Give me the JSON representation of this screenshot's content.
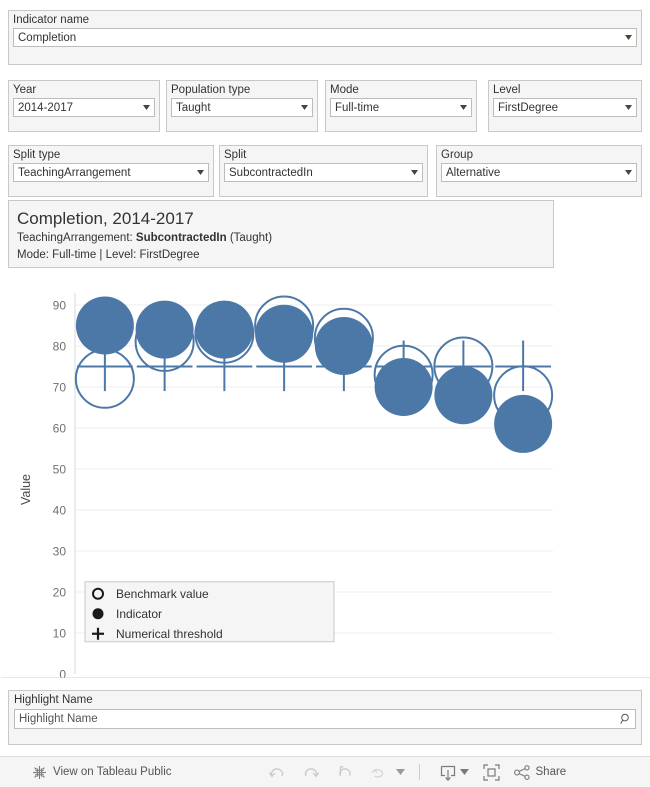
{
  "filters": {
    "indicator": {
      "label": "Indicator name",
      "value": "Completion"
    },
    "year": {
      "label": "Year",
      "value": "2014-2017"
    },
    "population_type": {
      "label": "Population type",
      "value": "Taught"
    },
    "mode": {
      "label": "Mode",
      "value": "Full-time"
    },
    "level": {
      "label": "Level",
      "value": "FirstDegree"
    },
    "split_type": {
      "label": "Split type",
      "value": "TeachingArrangement"
    },
    "split": {
      "label": "Split",
      "value": "SubcontractedIn"
    },
    "group": {
      "label": "Group",
      "value": "Alternative"
    }
  },
  "title_card": {
    "main": "Completion, 2014-2017",
    "sub1_prefix": "TeachingArrangement: ",
    "sub1_bold": "SubcontractedIn",
    "sub1_suffix": " (Taught)",
    "sub2": "Mode: Full-time | Level: FirstDegree"
  },
  "highlight": {
    "label": "Highlight Name",
    "value": "Highlight Name",
    "placeholder": "Highlight Name",
    "icon": "search-icon"
  },
  "toolbar": {
    "logo_icon": "tableau-logo-icon",
    "view_label": "View on Tableau Public",
    "undo_icon": "undo-icon",
    "redo_icon": "redo-icon",
    "revert_icon": "revert-icon",
    "refresh_icon": "refresh-icon",
    "pause_caret_icon": "chevron-down-icon",
    "download_icon": "download-icon",
    "download_caret_icon": "chevron-down-icon",
    "fullscreen_icon": "fullscreen-icon",
    "share_icon": "share-icon",
    "share_label": "Share"
  },
  "colors": {
    "mark_blue": "#4c78a8",
    "panel_bg": "#f5f5f5",
    "panel_border": "#c8c8c4",
    "gridline": "#ededed",
    "axis_text": "#707070"
  },
  "chart_data": {
    "type": "scatter",
    "title": "Completion, 2014-2017",
    "xlabel": "",
    "ylabel": "Value",
    "ylim": [
      0,
      90
    ],
    "yticks": [
      0,
      10,
      20,
      30,
      40,
      50,
      60,
      70,
      80,
      90
    ],
    "grid": true,
    "legend_position": "inside-bottom-left",
    "legend": [
      {
        "marker": "open-circle",
        "label": "Benchmark value"
      },
      {
        "marker": "filled-circle",
        "label": "Indicator"
      },
      {
        "marker": "plus",
        "label": "Numerical threshold"
      }
    ],
    "series": [
      {
        "name": "Indicator",
        "marker": "filled-circle",
        "values": [
          85,
          84,
          84,
          83,
          80,
          70,
          68,
          61
        ]
      },
      {
        "name": "Benchmark value",
        "marker": "open-circle",
        "values": [
          72,
          81,
          83,
          85,
          82,
          73,
          75,
          68
        ]
      },
      {
        "name": "Numerical threshold",
        "marker": "plus",
        "values": [
          75,
          75,
          75,
          75,
          75,
          75,
          75,
          75
        ]
      }
    ],
    "x": [
      1,
      2,
      3,
      4,
      5,
      6,
      7,
      8
    ],
    "marker_radius_px": 29,
    "threshold_whisker_low": 69
  }
}
